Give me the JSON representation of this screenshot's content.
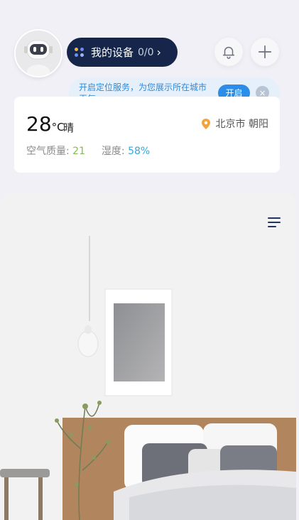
{
  "header": {
    "device_label": "我的设备",
    "device_count": "0/0",
    "chevron": "›",
    "icons": {
      "avatar": "robot-avatar-icon",
      "bell": "bell-icon",
      "plus": "plus-icon",
      "devices": "grid-dots-icon"
    }
  },
  "location_tip": {
    "message": "开启定位服务，为您展示所在城市天气",
    "enable_label": "开启",
    "close_label": "×"
  },
  "weather": {
    "temperature": "28",
    "unit": "°C",
    "condition": "晴",
    "location": "北京市 朝阳",
    "air_quality_label": "空气质量:",
    "air_quality_value": "21",
    "humidity_label": "湿度:",
    "humidity_value": "58%"
  },
  "room": {
    "menu_icon": "list-menu-icon"
  },
  "colors": {
    "pill_bg": "#16254a",
    "accent_blue": "#2b8de8",
    "air_good": "#7fbf4a",
    "humidity": "#36a8d8",
    "location_pin": "#f4a23a"
  }
}
